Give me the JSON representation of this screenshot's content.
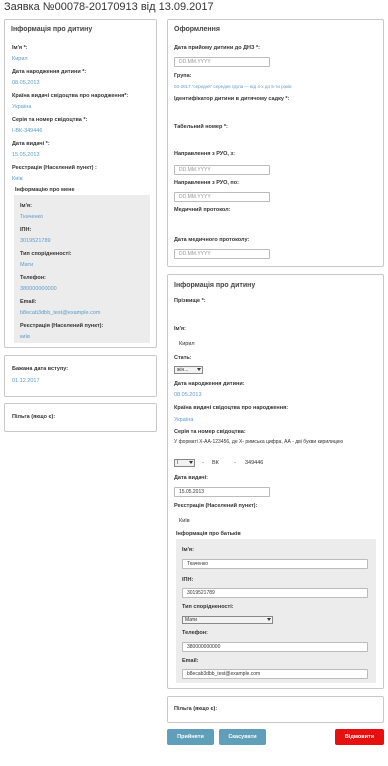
{
  "page_title": "Заявка №00078-20170913 від 13.09.2017",
  "left_child": {
    "title": "Інформація про дитину",
    "name_label": "Ім'я *:",
    "name_value": "Кирил",
    "birthdate_label": "Дата народження дитини *:",
    "birthdate_value": "08.05.2013",
    "country_label": "Країна видачі свідоцтва про народження*:",
    "country_value": "Україна",
    "cert_label": "Серія та номер свідоцтва *:",
    "cert_value": "І-ВК-349446",
    "issue_label": "Дата видачі *:",
    "issue_value": "15.05.2013",
    "reg_label": "Реєстрація (Населений пункт) :",
    "reg_value": "Київ",
    "about_me_title": "Інформацію про мене",
    "me_name_label": "Ім'я:",
    "me_name_value": "Ткаченко",
    "me_ipn_label": "ІПН:",
    "me_ipn_value": "3019521789",
    "me_relation_label": "Тип спорідненості:",
    "me_relation_value": "Мати",
    "me_phone_label": "Телефон:",
    "me_phone_value": "380000000000",
    "me_email_label": "Email:",
    "me_email_value": "b8ecab3dbb_test@example.com",
    "me_reg_label": "Реєстрація (Населений пункт):",
    "me_reg_value": "київ"
  },
  "desired_date": {
    "label": "Бажана дата вступу:",
    "value": "01.12.2017"
  },
  "benefit_left": {
    "label": "Пільга (якщо є):"
  },
  "registration": {
    "title": "Оформлення",
    "admission_label": "Дата прийому дитини до ДНЗ *:",
    "admission_placeholder": "DD.MM.YYYY",
    "group_label": "Група:",
    "group_value": "03-2017 \"середня\" середня група — від 4-х до 5-ти років",
    "id_label": "Ідентифікатор дитини в дитячому садку *:",
    "tab_label": "Табельний номер *:",
    "rvo_from_label": "Направлення з РУО, з:",
    "rvo_from_placeholder": "DD.MM.YYYY",
    "rvo_to_label": "Направлення з РУО, по:",
    "rvo_to_placeholder": "DD.MM.YYYY",
    "med_label": "Медичний протокол:",
    "med_date_label": "Дата медичного протоколу:",
    "med_date_placeholder": "DD.MM.YYYY"
  },
  "right_child": {
    "title": "Інформація про дитину",
    "surname_label": "Прізвище *:",
    "name_label": "Ім'я:",
    "name_value": "Кирил",
    "sex_label": "Стать:",
    "sex_value": "жін...",
    "birthdate_label": "Дата народження дитини:",
    "birthdate_value": "08.05.2013",
    "country_label": "Країна видачі свідоцтва про народження:",
    "country_value": "Україна",
    "cert_label": "Серія та номер свідоцтва:",
    "cert_hint": "У форматі Х-АА-123456, де Х- римська цифра, АА - дві букви кирилицею",
    "cert_roman": "І",
    "cert_dash1": "-",
    "cert_letters": "ВК",
    "cert_dash2": "-",
    "cert_number": "349446",
    "issue_label": "Дата видачі:",
    "issue_value": "15.05.2013",
    "reg_label": "Реєстрація (Населений пункт):",
    "reg_value": "Київ"
  },
  "parents": {
    "title": "Інформація про батьків",
    "name_label": "Ім'я:",
    "name_value": "Ткаченко",
    "ipn_label": "ІПН:",
    "ipn_value": "3019521789",
    "relation_label": "Тип спорідненості:",
    "relation_value": "Мати",
    "phone_label": "Телефон:",
    "phone_value": "380000000000",
    "email_label": "Email:",
    "email_value": "b8ecab3dbb_test@example.com"
  },
  "benefit_right": {
    "label": "Пільга (якщо є):"
  },
  "buttons": {
    "accept": "Прийняти",
    "cancel": "Скасувати",
    "reject": "Відмовити"
  },
  "colors": {
    "accent_blue": "#5b9bc9",
    "button_blue": "#5f9fb9",
    "button_red": "#e8100f"
  }
}
